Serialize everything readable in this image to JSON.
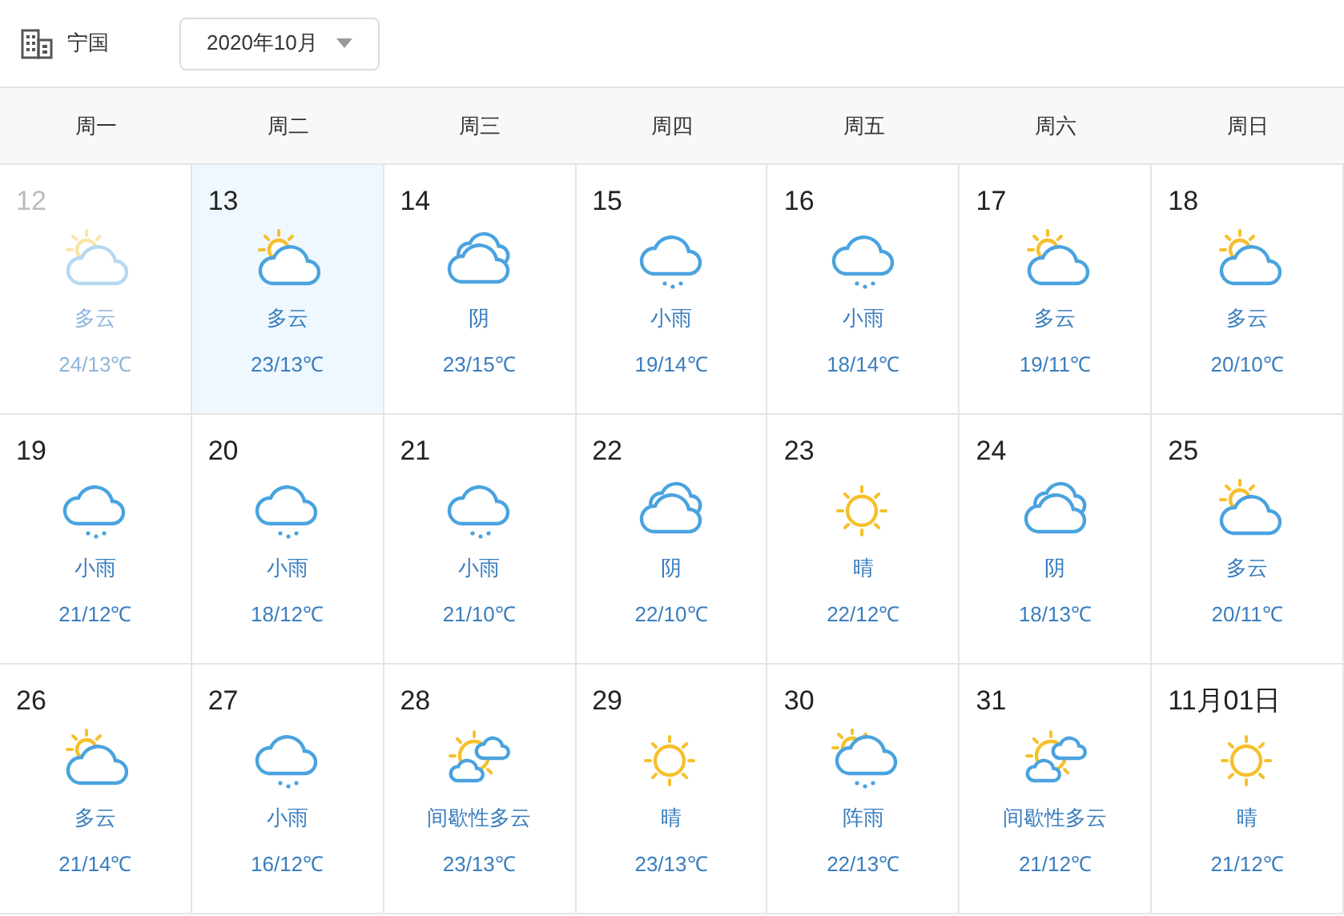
{
  "location": "宁国",
  "month_select": {
    "value": "2020年10月"
  },
  "weekdays": [
    "周一",
    "周二",
    "周三",
    "周四",
    "周五",
    "周六",
    "周日"
  ],
  "days": [
    {
      "date": "12",
      "kind": "partly",
      "desc": "多云",
      "temp": "24/13℃",
      "faded": true,
      "selected": false
    },
    {
      "date": "13",
      "kind": "partly",
      "desc": "多云",
      "temp": "23/13℃",
      "faded": false,
      "selected": true
    },
    {
      "date": "14",
      "kind": "cloudy",
      "desc": "阴",
      "temp": "23/15℃",
      "faded": false,
      "selected": false
    },
    {
      "date": "15",
      "kind": "rain",
      "desc": "小雨",
      "temp": "19/14℃",
      "faded": false,
      "selected": false
    },
    {
      "date": "16",
      "kind": "rain",
      "desc": "小雨",
      "temp": "18/14℃",
      "faded": false,
      "selected": false
    },
    {
      "date": "17",
      "kind": "partly",
      "desc": "多云",
      "temp": "19/11℃",
      "faded": false,
      "selected": false
    },
    {
      "date": "18",
      "kind": "partly",
      "desc": "多云",
      "temp": "20/10℃",
      "faded": false,
      "selected": false
    },
    {
      "date": "19",
      "kind": "rain",
      "desc": "小雨",
      "temp": "21/12℃",
      "faded": false,
      "selected": false
    },
    {
      "date": "20",
      "kind": "rain",
      "desc": "小雨",
      "temp": "18/12℃",
      "faded": false,
      "selected": false
    },
    {
      "date": "21",
      "kind": "rain",
      "desc": "小雨",
      "temp": "21/10℃",
      "faded": false,
      "selected": false
    },
    {
      "date": "22",
      "kind": "cloudy",
      "desc": "阴",
      "temp": "22/10℃",
      "faded": false,
      "selected": false
    },
    {
      "date": "23",
      "kind": "sunny",
      "desc": "晴",
      "temp": "22/12℃",
      "faded": false,
      "selected": false
    },
    {
      "date": "24",
      "kind": "cloudy",
      "desc": "阴",
      "temp": "18/13℃",
      "faded": false,
      "selected": false
    },
    {
      "date": "25",
      "kind": "partly",
      "desc": "多云",
      "temp": "20/11℃",
      "faded": false,
      "selected": false
    },
    {
      "date": "26",
      "kind": "partly",
      "desc": "多云",
      "temp": "21/14℃",
      "faded": false,
      "selected": false
    },
    {
      "date": "27",
      "kind": "rain",
      "desc": "小雨",
      "temp": "16/12℃",
      "faded": false,
      "selected": false
    },
    {
      "date": "28",
      "kind": "intermittent",
      "desc": "间歇性多云",
      "temp": "23/13℃",
      "faded": false,
      "selected": false
    },
    {
      "date": "29",
      "kind": "sunny",
      "desc": "晴",
      "temp": "23/13℃",
      "faded": false,
      "selected": false
    },
    {
      "date": "30",
      "kind": "shower",
      "desc": "阵雨",
      "temp": "22/13℃",
      "faded": false,
      "selected": false
    },
    {
      "date": "31",
      "kind": "intermittent",
      "desc": "间歇性多云",
      "temp": "21/12℃",
      "faded": false,
      "selected": false
    },
    {
      "date": "11月01日",
      "kind": "sunny",
      "desc": "晴",
      "temp": "21/12℃",
      "faded": false,
      "selected": false
    }
  ]
}
